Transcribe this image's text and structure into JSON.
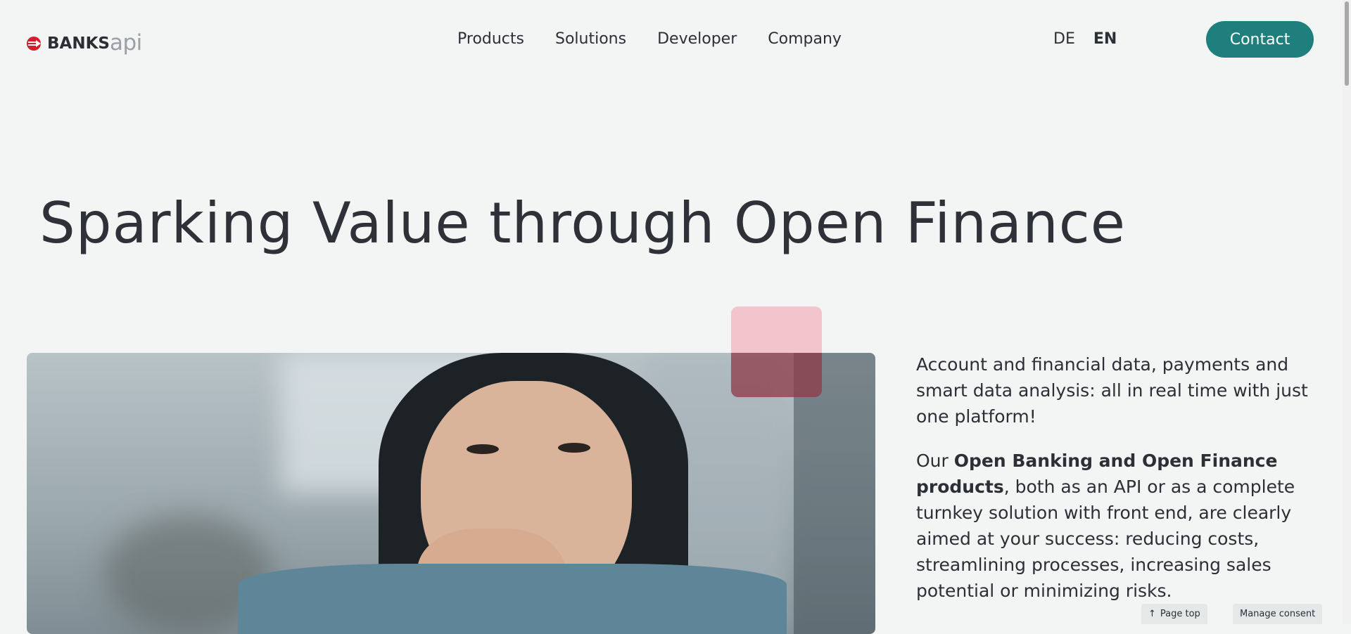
{
  "header": {
    "logo": {
      "banks": "BANKS",
      "api": "api"
    },
    "nav": [
      "Products",
      "Solutions",
      "Developer",
      "Company"
    ],
    "lang": [
      "DE",
      "EN"
    ],
    "active_lang": "EN",
    "contact_label": "Contact"
  },
  "hero": {
    "title": "Sparking Value through Open Finance",
    "paragraph1": "Account and financial data, payments and smart data analysis: all in real time with just one platform!",
    "paragraph2": {
      "lead": "Our ",
      "bold": "Open Banking and Open Finance products",
      "rest": ", both as an API or as a complete turnkey solution with front end, are clearly aimed at your success: reducing costs, streamlining processes, increasing sales potential or minimizing risks."
    }
  },
  "floating": {
    "page_top": "Page top",
    "manage_consent": "Manage consent"
  },
  "colors": {
    "accent": "#1f7f7c",
    "brand_red": "#d21f2b",
    "text": "#2c3036",
    "background": "#f3f4f4"
  },
  "icons": [
    "banksapi-logo-icon",
    "arrow-up-icon"
  ]
}
